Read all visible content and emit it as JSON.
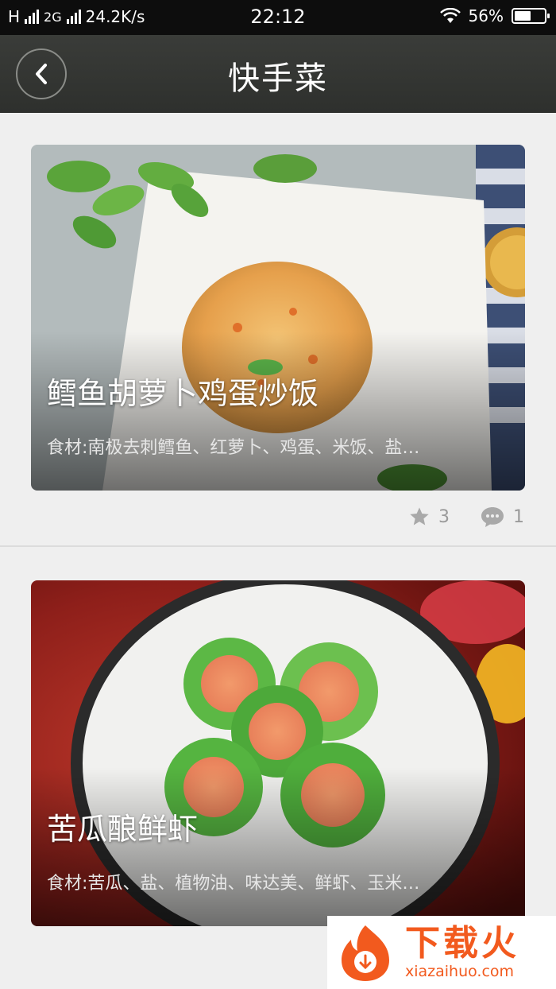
{
  "status_bar": {
    "network_type": "H",
    "network_2g": "2G",
    "speed": "24.2K/s",
    "time": "22:12",
    "battery": "56%",
    "battery_level": 0.56
  },
  "header": {
    "title": "快手菜",
    "back_icon": "chevron-left-icon"
  },
  "recipes": [
    {
      "title": "鳕鱼胡萝卜鸡蛋炒饭",
      "ingredients": "食材:南极去刺鳕鱼、红萝卜、鸡蛋、米饭、盐…",
      "favorites": "3",
      "comments": "1"
    },
    {
      "title": "苦瓜酿鲜虾",
      "ingredients": "食材:苦瓜、盐、植物油、味达美、鲜虾、玉米…"
    }
  ],
  "watermark": {
    "main": "下载火",
    "sub": "xiazaihuo.com"
  },
  "colors": {
    "app_bar": "#3a3c39",
    "background": "#efefef",
    "meta_gray": "#9a9a9a",
    "watermark_orange": "#f25a1e"
  }
}
